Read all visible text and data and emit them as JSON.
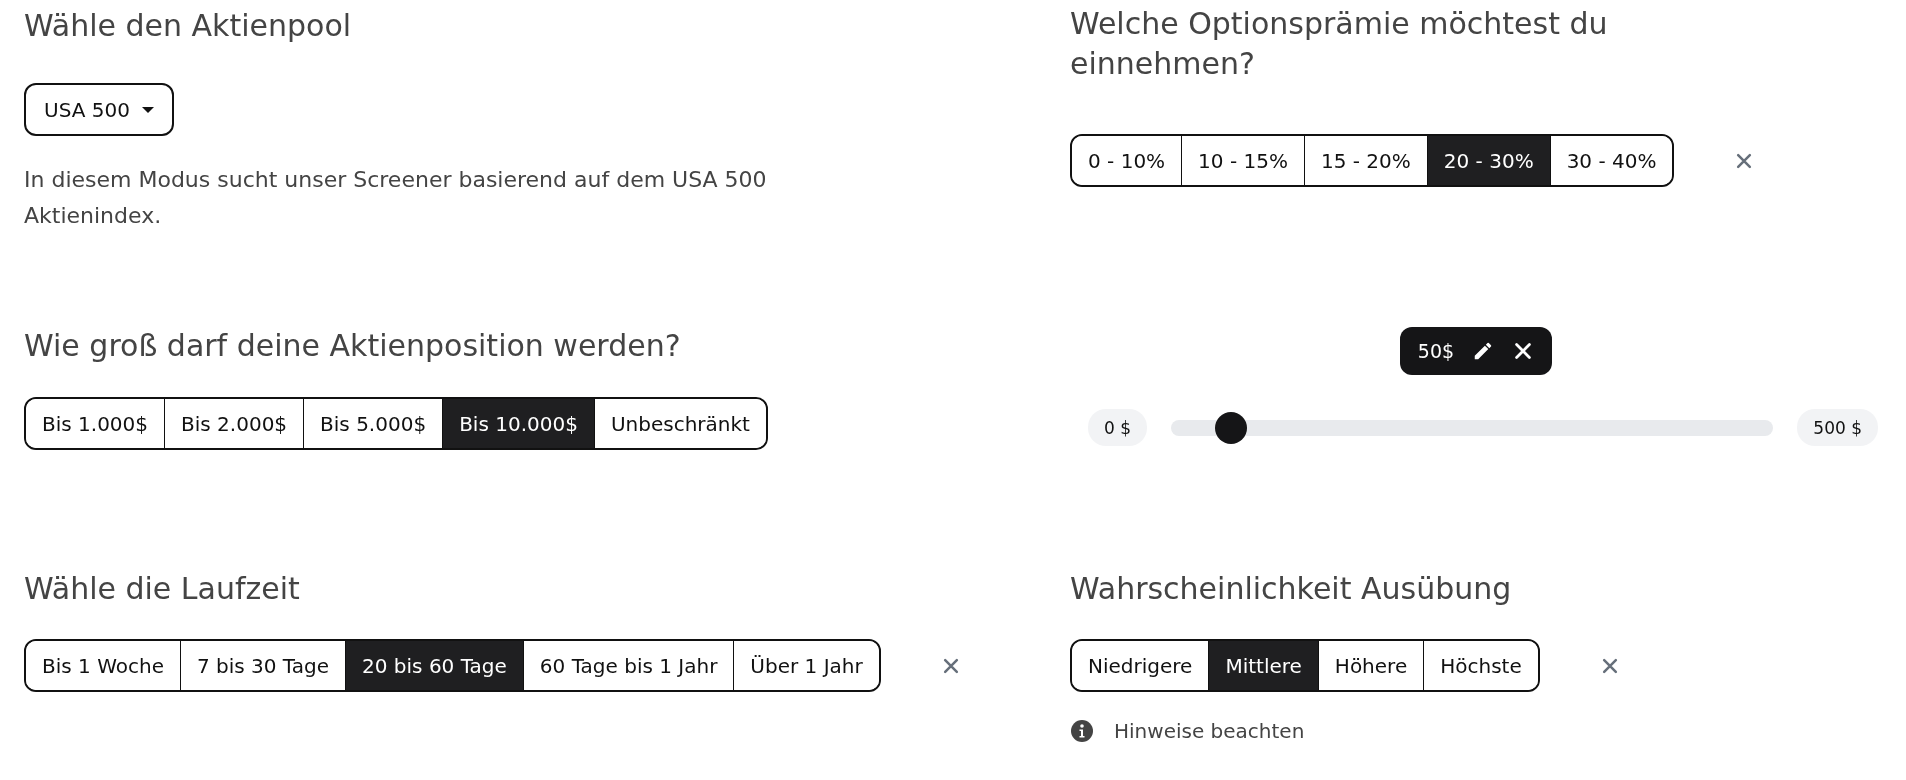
{
  "stock_pool": {
    "heading": "Wähle den Aktienpool",
    "dropdown": {
      "value": "USA 500"
    },
    "description": "In diesem Modus sucht unser Screener basierend auf dem USA 500 Aktienindex."
  },
  "premium": {
    "heading": "Welche Optionsprämie möchtest du einnehmen?",
    "options": [
      {
        "label": "0 - 10%",
        "selected": false
      },
      {
        "label": "10 - 15%",
        "selected": false
      },
      {
        "label": "15 - 20%",
        "selected": false
      },
      {
        "label": "20 - 30%",
        "selected": true
      },
      {
        "label": "30 - 40%",
        "selected": false
      }
    ]
  },
  "position_size": {
    "heading": "Wie groß darf deine Aktienposition werden?",
    "options": [
      {
        "label": "Bis 1.000$",
        "selected": false
      },
      {
        "label": "Bis 2.000$",
        "selected": false
      },
      {
        "label": "Bis 5.000$",
        "selected": false
      },
      {
        "label": "Bis 10.000$",
        "selected": true
      },
      {
        "label": "Unbeschränkt",
        "selected": false
      }
    ]
  },
  "price_slider": {
    "value_label": "50$",
    "min_label": "0 $",
    "max_label": "500 $",
    "level": 0.1
  },
  "term": {
    "heading": "Wähle die Laufzeit",
    "options": [
      {
        "label": "Bis 1 Woche",
        "selected": false
      },
      {
        "label": "7 bis 30 Tage",
        "selected": false
      },
      {
        "label": "20 bis 60 Tage",
        "selected": true
      },
      {
        "label": "60 Tage bis 1 Jahr",
        "selected": false
      },
      {
        "label": "Über 1 Jahr",
        "selected": false
      }
    ]
  },
  "probability": {
    "heading": "Wahrscheinlichkeit Ausübung",
    "options": [
      {
        "label": "Niedrigere",
        "selected": false
      },
      {
        "label": "Mittlere",
        "selected": true
      },
      {
        "label": "Höhere",
        "selected": false
      },
      {
        "label": "Höchste",
        "selected": false
      }
    ],
    "note": "Hinweise beachten"
  }
}
